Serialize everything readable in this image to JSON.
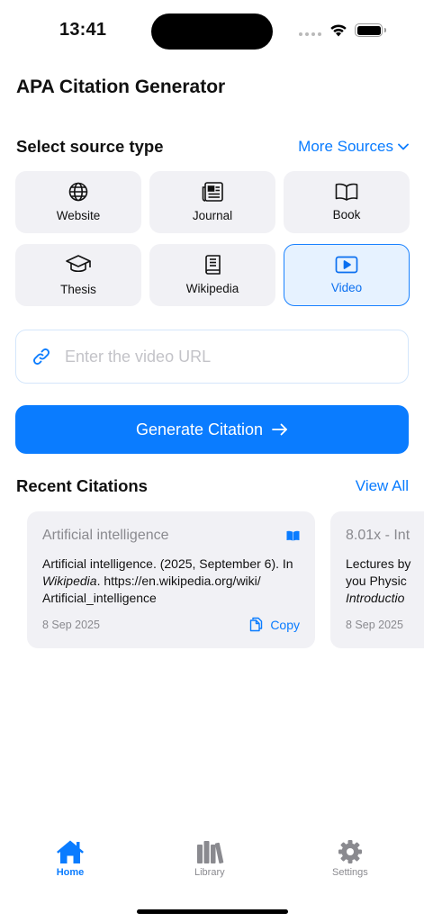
{
  "status": {
    "time": "13:41"
  },
  "app": {
    "title": "APA Citation Generator"
  },
  "source_section": {
    "title": "Select source type",
    "more_label": "More Sources",
    "types": [
      {
        "label": "Website",
        "icon": "globe-icon"
      },
      {
        "label": "Journal",
        "icon": "newspaper-icon"
      },
      {
        "label": "Book",
        "icon": "book-open-icon"
      },
      {
        "label": "Thesis",
        "icon": "graduation-cap-icon"
      },
      {
        "label": "Wikipedia",
        "icon": "book-closed-icon"
      },
      {
        "label": "Video",
        "icon": "play-rectangle-icon",
        "selected": true
      }
    ]
  },
  "url_input": {
    "placeholder": "Enter the video URL",
    "value": ""
  },
  "generate_button": {
    "label": "Generate Citation"
  },
  "recent": {
    "title": "Recent Citations",
    "view_all_label": "View All",
    "cards": [
      {
        "title": "Artificial intelligence",
        "citation_pre": "Artificial intelligence. (2025, September 6). In ",
        "citation_italic": "Wikipedia",
        "citation_post": ". https://en.wikipedia.org/wiki/ Artificial_intelligence",
        "date": "8 Sep 2025",
        "copy_label": "Copy",
        "icon": "book-open-icon"
      },
      {
        "title": "8.01x - Int",
        "citation_pre": "Lectures by",
        "citation_line2": "you  Physic",
        "citation_italic": "Introductio",
        "date": "8 Sep 2025"
      }
    ]
  },
  "tabbar": {
    "items": [
      {
        "label": "Home",
        "icon": "house-icon",
        "active": true
      },
      {
        "label": "Library",
        "icon": "books-icon"
      },
      {
        "label": "Settings",
        "icon": "gear-icon"
      }
    ]
  },
  "colors": {
    "accent": "#0a7cff",
    "tile_bg": "#f1f1f5",
    "selected_bg": "#e6f2ff"
  }
}
